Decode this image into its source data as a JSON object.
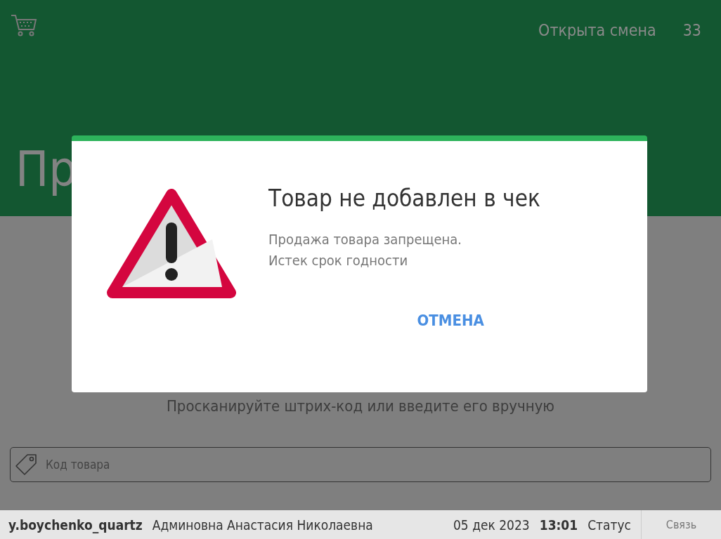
{
  "header": {
    "shift_status": "Открыта смена",
    "shift_number": "33",
    "page_title": "Пр"
  },
  "main": {
    "instruction": "Просканируйте штрих-код или введите его вручную",
    "code_field": {
      "placeholder": "Код товара"
    }
  },
  "status_bar": {
    "login": "y.boychenko_quartz",
    "user_name": "Админовна Анастасия Николаевна",
    "date": "05 дек 2023",
    "time": "13:01",
    "status": "Статус",
    "connection_button": "Связь"
  },
  "dialog": {
    "title": "Товар не добавлен в чек",
    "message": [
      "Продажа товара запрещена.",
      "Истек срок годности"
    ],
    "buttons": [
      "ОТМЕНА"
    ]
  }
}
